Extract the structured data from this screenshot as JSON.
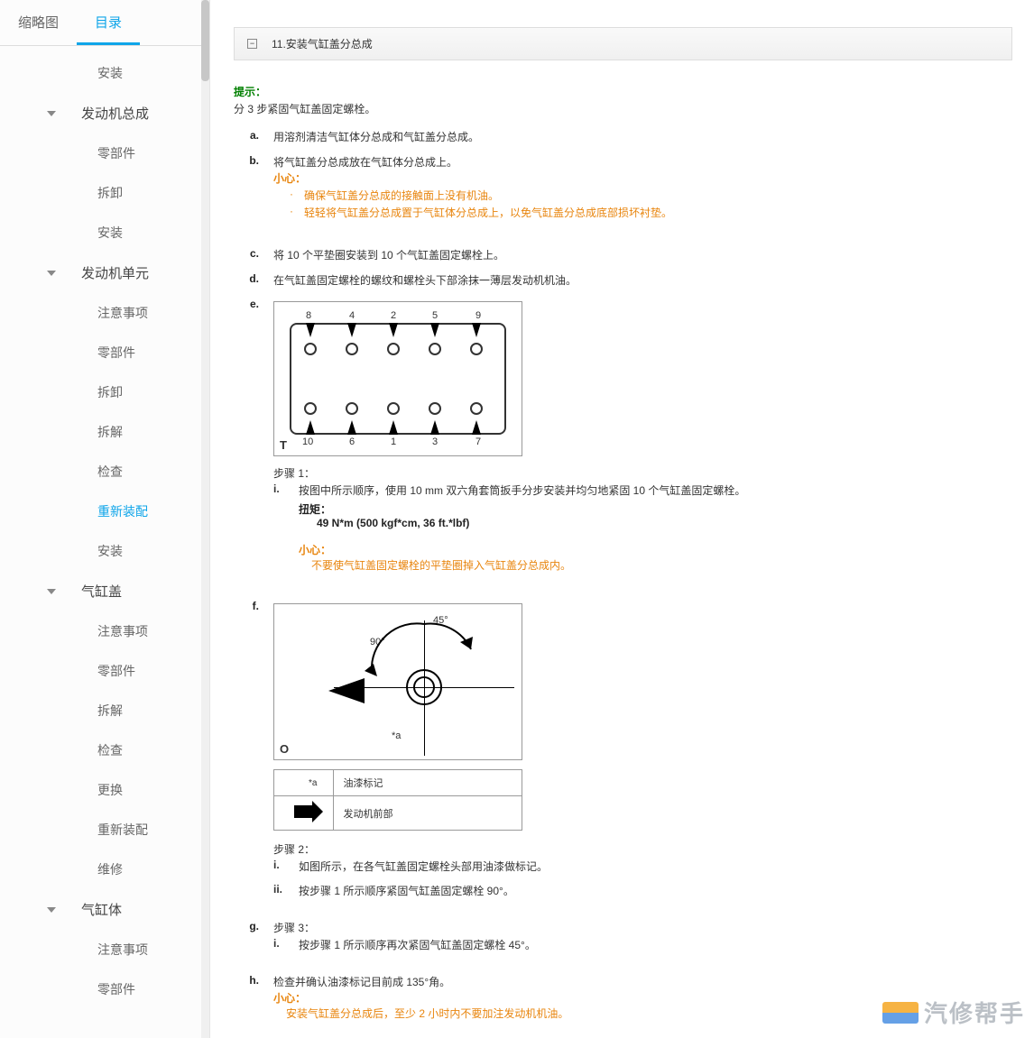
{
  "tabs": {
    "thumb": "缩略图",
    "toc": "目录"
  },
  "sidebar": {
    "install0": "安装",
    "g1": {
      "label": "发动机总成",
      "items": [
        "零部件",
        "拆卸",
        "安装"
      ]
    },
    "g2": {
      "label": "发动机单元",
      "items": [
        "注意事项",
        "零部件",
        "拆卸",
        "拆解",
        "检查",
        "重新装配",
        "安装"
      ]
    },
    "g3": {
      "label": "气缸盖",
      "items": [
        "注意事项",
        "零部件",
        "拆解",
        "检查",
        "更换",
        "重新装配",
        "维修"
      ]
    },
    "g4": {
      "label": "气缸体",
      "items": [
        "注意事项",
        "零部件"
      ]
    }
  },
  "header": {
    "title": "11.安装气缸盖分总成"
  },
  "hint": {
    "label": "提示：",
    "text": "分 3 步紧固气缸盖固定螺栓。"
  },
  "steps": {
    "a": "用溶剂清洁气缸体分总成和气缸盖分总成。",
    "b": "将气缸盖分总成放在气缸体分总成上。",
    "b_caution_label": "小心：",
    "b_caution1": "确保气缸盖分总成的接触面上没有机油。",
    "b_caution2": "轻轻将气缸盖分总成置于气缸体分总成上，以免气缸盖分总成底部损坏衬垫。",
    "c": "将 10 个平垫圈安装到 10 个气缸盖固定螺栓上。",
    "d": "在气缸盖固定螺栓的螺纹和螺栓头下部涂抹一薄层发动机机油。",
    "e_step1_label": "步骤 1：",
    "e_step1_text": "按图中所示顺序，使用 10 mm 双六角套筒扳手分步安装并均匀地紧固 10 个气缸盖固定螺栓。",
    "e_torque_label": "扭矩：",
    "e_torque_val": "49 N*m (500 kgf*cm, 36 ft.*lbf)",
    "e_caution_label": "小心：",
    "e_caution_text": "不要使气缸盖固定螺栓的平垫圈掉入气缸盖分总成内。",
    "f_mark_a": "*a",
    "f_paint": "油漆标记",
    "f_front": "发动机前部",
    "f_step2_label": "步骤 2：",
    "f_step2_i": "如图所示，在各气缸盖固定螺栓头部用油漆做标记。",
    "f_step2_ii": "按步骤 1 所示顺序紧固气缸盖固定螺栓 90°。",
    "g_step3_label": "步骤 3：",
    "g_step3_i": "按步骤 1 所示顺序再次紧固气缸盖固定螺栓 45°。",
    "h": "检查并确认油漆标记目前成 135°角。",
    "h_caution_label": "小心：",
    "h_caution_text": "安装气缸盖分总成后，至少 2 小时内不要加注发动机机油。"
  },
  "diagram1": {
    "letter": "T",
    "nums": [
      "8",
      "4",
      "2",
      "5",
      "9",
      "10",
      "6",
      "1",
      "3",
      "7"
    ],
    "angles": {
      "a45": "45°",
      "a90": "90°",
      "star": "*a"
    }
  },
  "diagram2": {
    "letter": "O"
  },
  "watermark": "汽修帮手"
}
